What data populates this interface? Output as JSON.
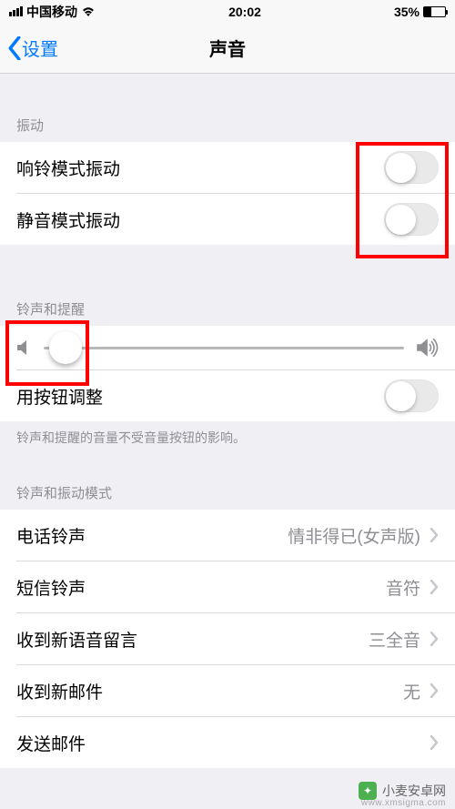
{
  "statusBar": {
    "carrier": "中国移动",
    "time": "20:02",
    "batteryPercent": "35%"
  },
  "nav": {
    "back": "设置",
    "title": "声音"
  },
  "sections": {
    "vibration": {
      "header": "振动",
      "ringVibrate": "响铃模式振动",
      "silentVibrate": "静音模式振动"
    },
    "ringAlert": {
      "header": "铃声和提醒",
      "buttonAdjust": "用按钮调整",
      "footer": "铃声和提醒的音量不受音量按钮的影响。"
    },
    "patterns": {
      "header": "铃声和振动模式",
      "ringtone": {
        "label": "电话铃声",
        "value": "情非得已(女声版)"
      },
      "textTone": {
        "label": "短信铃声",
        "value": "音符"
      },
      "newVoicemail": {
        "label": "收到新语音留言",
        "value": "三全音"
      },
      "newMail": {
        "label": "收到新邮件",
        "value": "无"
      },
      "sentMail": {
        "label": "发送邮件",
        "value": ""
      }
    }
  },
  "watermark": {
    "text": "小麦安卓网",
    "url": "www.xmsigma.com"
  }
}
